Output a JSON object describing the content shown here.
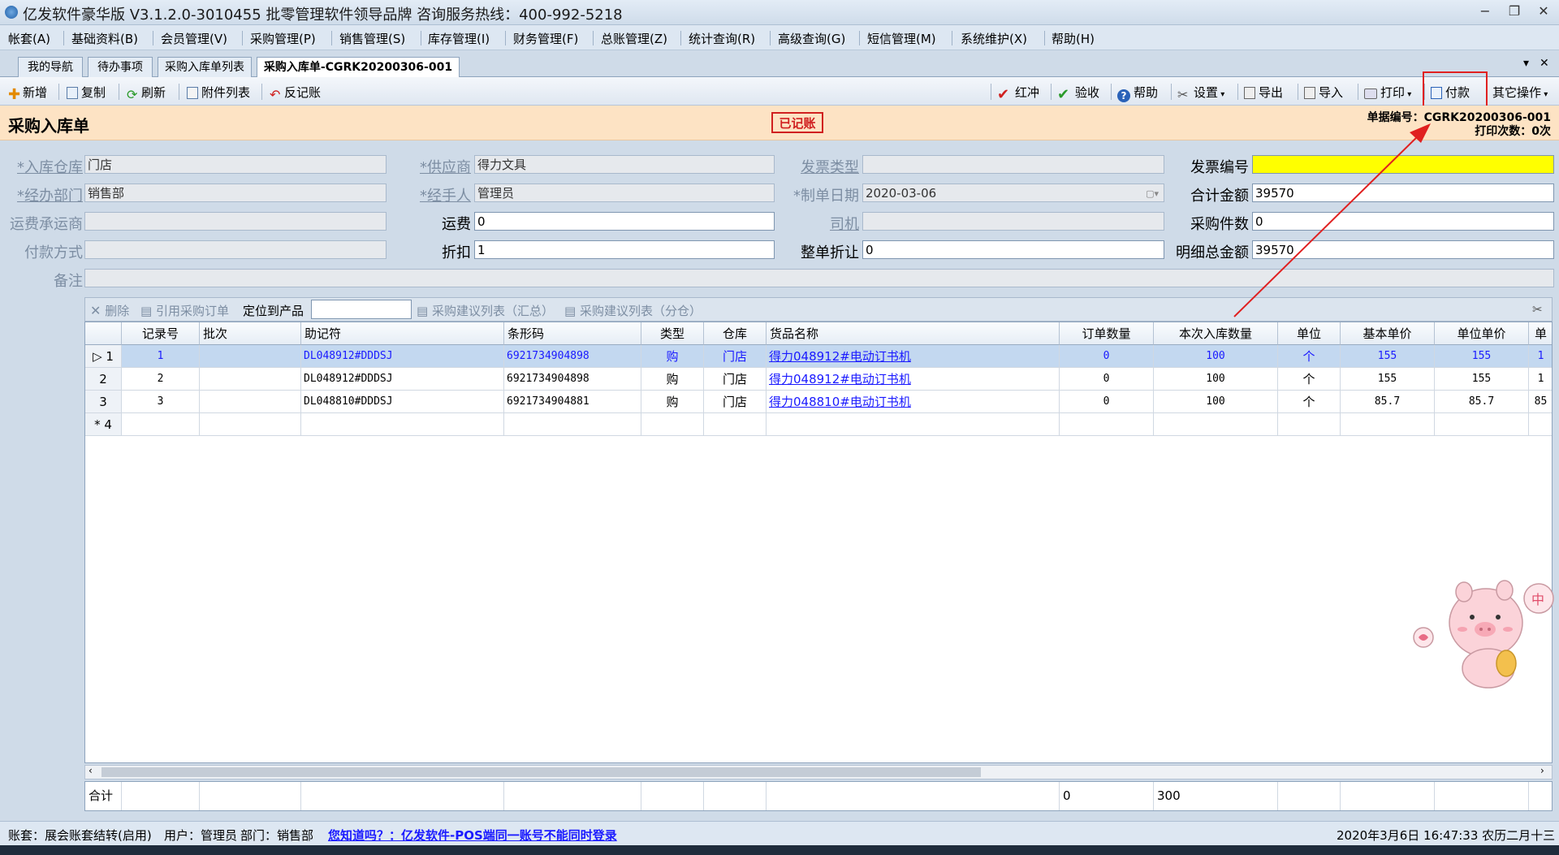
{
  "window": {
    "title": "亿发软件豪华版 V3.1.2.0-3010455 批零管理软件领导品牌 咨询服务热线：400-992-5218",
    "min": "−",
    "restore": "❐",
    "close": "✕"
  },
  "menu": [
    "帐套(A)",
    "基础资料(B)",
    "会员管理(V)",
    "采购管理(P)",
    "销售管理(S)",
    "库存管理(I)",
    "财务管理(F)",
    "总账管理(Z)",
    "统计查询(R)",
    "高级查询(G)",
    "短信管理(M)",
    "系统维护(X)",
    "帮助(H)"
  ],
  "tabs": [
    "我的导航",
    "待办事项",
    "采购入库单列表",
    "采购入库单-CGRK20200306-001"
  ],
  "tab_controls": {
    "dropdown": "▾",
    "close": "✕"
  },
  "toolbar_left": [
    "新增",
    "复制",
    "刷新",
    "附件列表",
    "反记账"
  ],
  "toolbar_right": [
    "红冲",
    "验收",
    "帮助",
    "设置",
    "导出",
    "导入",
    "打印",
    "付款",
    "其它操作"
  ],
  "header": {
    "title": "采购入库单",
    "stamp": "已记账",
    "doc_no": "单据编号：CGRK20200306-001",
    "print_count": "打印次数：0次"
  },
  "form": {
    "warehouse_label": "*入库仓库",
    "warehouse": "门店",
    "supplier_label": "*供应商",
    "supplier": "得力文具",
    "invoice_type_label": "发票类型",
    "invoice_type": "",
    "invoice_no_label": "发票编号",
    "invoice_no": "",
    "dept_label": "*经办部门",
    "dept": "销售部",
    "handler_label": "*经手人",
    "handler": "管理员",
    "date_label": "*制单日期",
    "date": "2020-03-06",
    "total_amount_label": "合计金额",
    "total_amount": "39570",
    "carrier_label": "运费承运商",
    "carrier": "",
    "freight_label": "运费",
    "freight": "0",
    "driver_label": "司机",
    "driver": "",
    "qty_label": "采购件数",
    "qty": "0",
    "pay_method_label": "付款方式",
    "pay_method": "",
    "discount_label": "折扣",
    "discount": "1",
    "order_discount_label": "整单折让",
    "order_discount": "0",
    "detail_total_label": "明细总金额",
    "detail_total": "39570",
    "remark_label": "备注",
    "remark": ""
  },
  "grid_tools": {
    "delete": "删除",
    "ref_order": "引用采购订单",
    "locate": "定位到产品",
    "locate_value": "",
    "suggest_sum": "采购建议列表（汇总）",
    "suggest_split": "采购建议列表（分仓）"
  },
  "grid": {
    "columns": [
      "",
      "记录号",
      "批次",
      "助记符",
      "条形码",
      "类型",
      "仓库",
      "货品名称",
      "订单数量",
      "本次入库数量",
      "单位",
      "基本单价",
      "单位单价",
      "单"
    ],
    "rows": [
      {
        "rh": "1",
        "no": "1",
        "batch": "",
        "code": "DL048912#DDDSJ",
        "barcode": "6921734904898",
        "type": "购",
        "wh": "门店",
        "name": "得力048912#电动订书机",
        "order_qty": "0",
        "in_qty": "100",
        "unit": "个",
        "base_price": "155",
        "unit_price": "155",
        "extra": "1"
      },
      {
        "rh": "2",
        "no": "2",
        "batch": "",
        "code": "DL048912#DDDSJ",
        "barcode": "6921734904898",
        "type": "购",
        "wh": "门店",
        "name": "得力048912#电动订书机",
        "order_qty": "0",
        "in_qty": "100",
        "unit": "个",
        "base_price": "155",
        "unit_price": "155",
        "extra": "1"
      },
      {
        "rh": "3",
        "no": "3",
        "batch": "",
        "code": "DL048810#DDDSJ",
        "barcode": "6921734904881",
        "type": "购",
        "wh": "门店",
        "name": "得力048810#电动订书机",
        "order_qty": "0",
        "in_qty": "100",
        "unit": "个",
        "base_price": "85.7",
        "unit_price": "85.7",
        "extra": "85"
      }
    ],
    "new_row": "* 4",
    "selected_marker": "▷ 1"
  },
  "totals": {
    "label": "合计",
    "order_qty": "0",
    "in_qty": "300"
  },
  "status": {
    "account": "账套：展会账套结转(启用)",
    "user": "用户：管理员",
    "dept": "部门：销售部",
    "tip": "您知道吗？：亿发软件-POS端同一账号不能同时登录",
    "datetime": "2020年3月6日 16:47:33 农历二月十三"
  },
  "mascot_bubble": "中",
  "colors": {
    "accent_red": "#e02020",
    "highlight_yellow": "#ffff00",
    "link_blue": "#1a1aff",
    "header_bg": "#fde3c4"
  }
}
